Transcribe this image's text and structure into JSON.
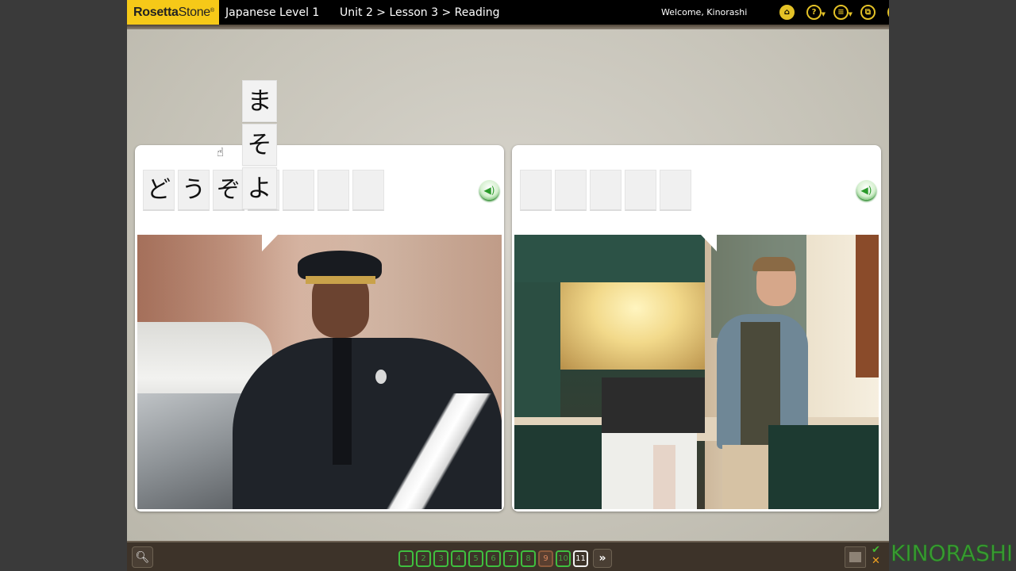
{
  "topbar": {
    "logo_bold": "Rosetta",
    "logo_rest": "Stone",
    "logo_reg": "®",
    "course": "Japanese Level 1",
    "breadcrumb": "Unit 2 > Lesson 3 > Reading",
    "welcome": "Welcome, Kinorashi",
    "icons": [
      {
        "name": "home-icon",
        "glyph": "⌂"
      },
      {
        "name": "help-icon",
        "glyph": "?"
      },
      {
        "name": "menu-list-icon",
        "glyph": "≡"
      },
      {
        "name": "window-icon",
        "glyph": "⧉"
      },
      {
        "name": "close-icon",
        "glyph": "✕"
      }
    ]
  },
  "floating_tiles": [
    "ま",
    "そ",
    "よ"
  ],
  "panels": [
    {
      "id": "left",
      "slots": [
        "ど",
        "う",
        "ぞ",
        "",
        "",
        "",
        ""
      ],
      "speaker_icon": "speaker-icon",
      "photo": "police officer leaning on patrol car"
    },
    {
      "id": "right",
      "slots": [
        "",
        "",
        "",
        "",
        ""
      ],
      "speaker_icon": "speaker-icon",
      "photo": "man standing in a kitchen"
    }
  ],
  "bottombar": {
    "zoom_icon": "magnifier-icon",
    "pages": [
      {
        "label": "1",
        "state": "correct"
      },
      {
        "label": "2",
        "state": "correct"
      },
      {
        "label": "3",
        "state": "correct"
      },
      {
        "label": "4",
        "state": "correct"
      },
      {
        "label": "5",
        "state": "correct"
      },
      {
        "label": "6",
        "state": "correct"
      },
      {
        "label": "7",
        "state": "correct"
      },
      {
        "label": "8",
        "state": "correct"
      },
      {
        "label": "9",
        "state": "incorrect"
      },
      {
        "label": "10",
        "state": "correct"
      },
      {
        "label": "11",
        "state": "current"
      }
    ],
    "next_label": "»",
    "check_mark": "✔",
    "cross_mark": "✕"
  },
  "watermark": "KINORASHI"
}
